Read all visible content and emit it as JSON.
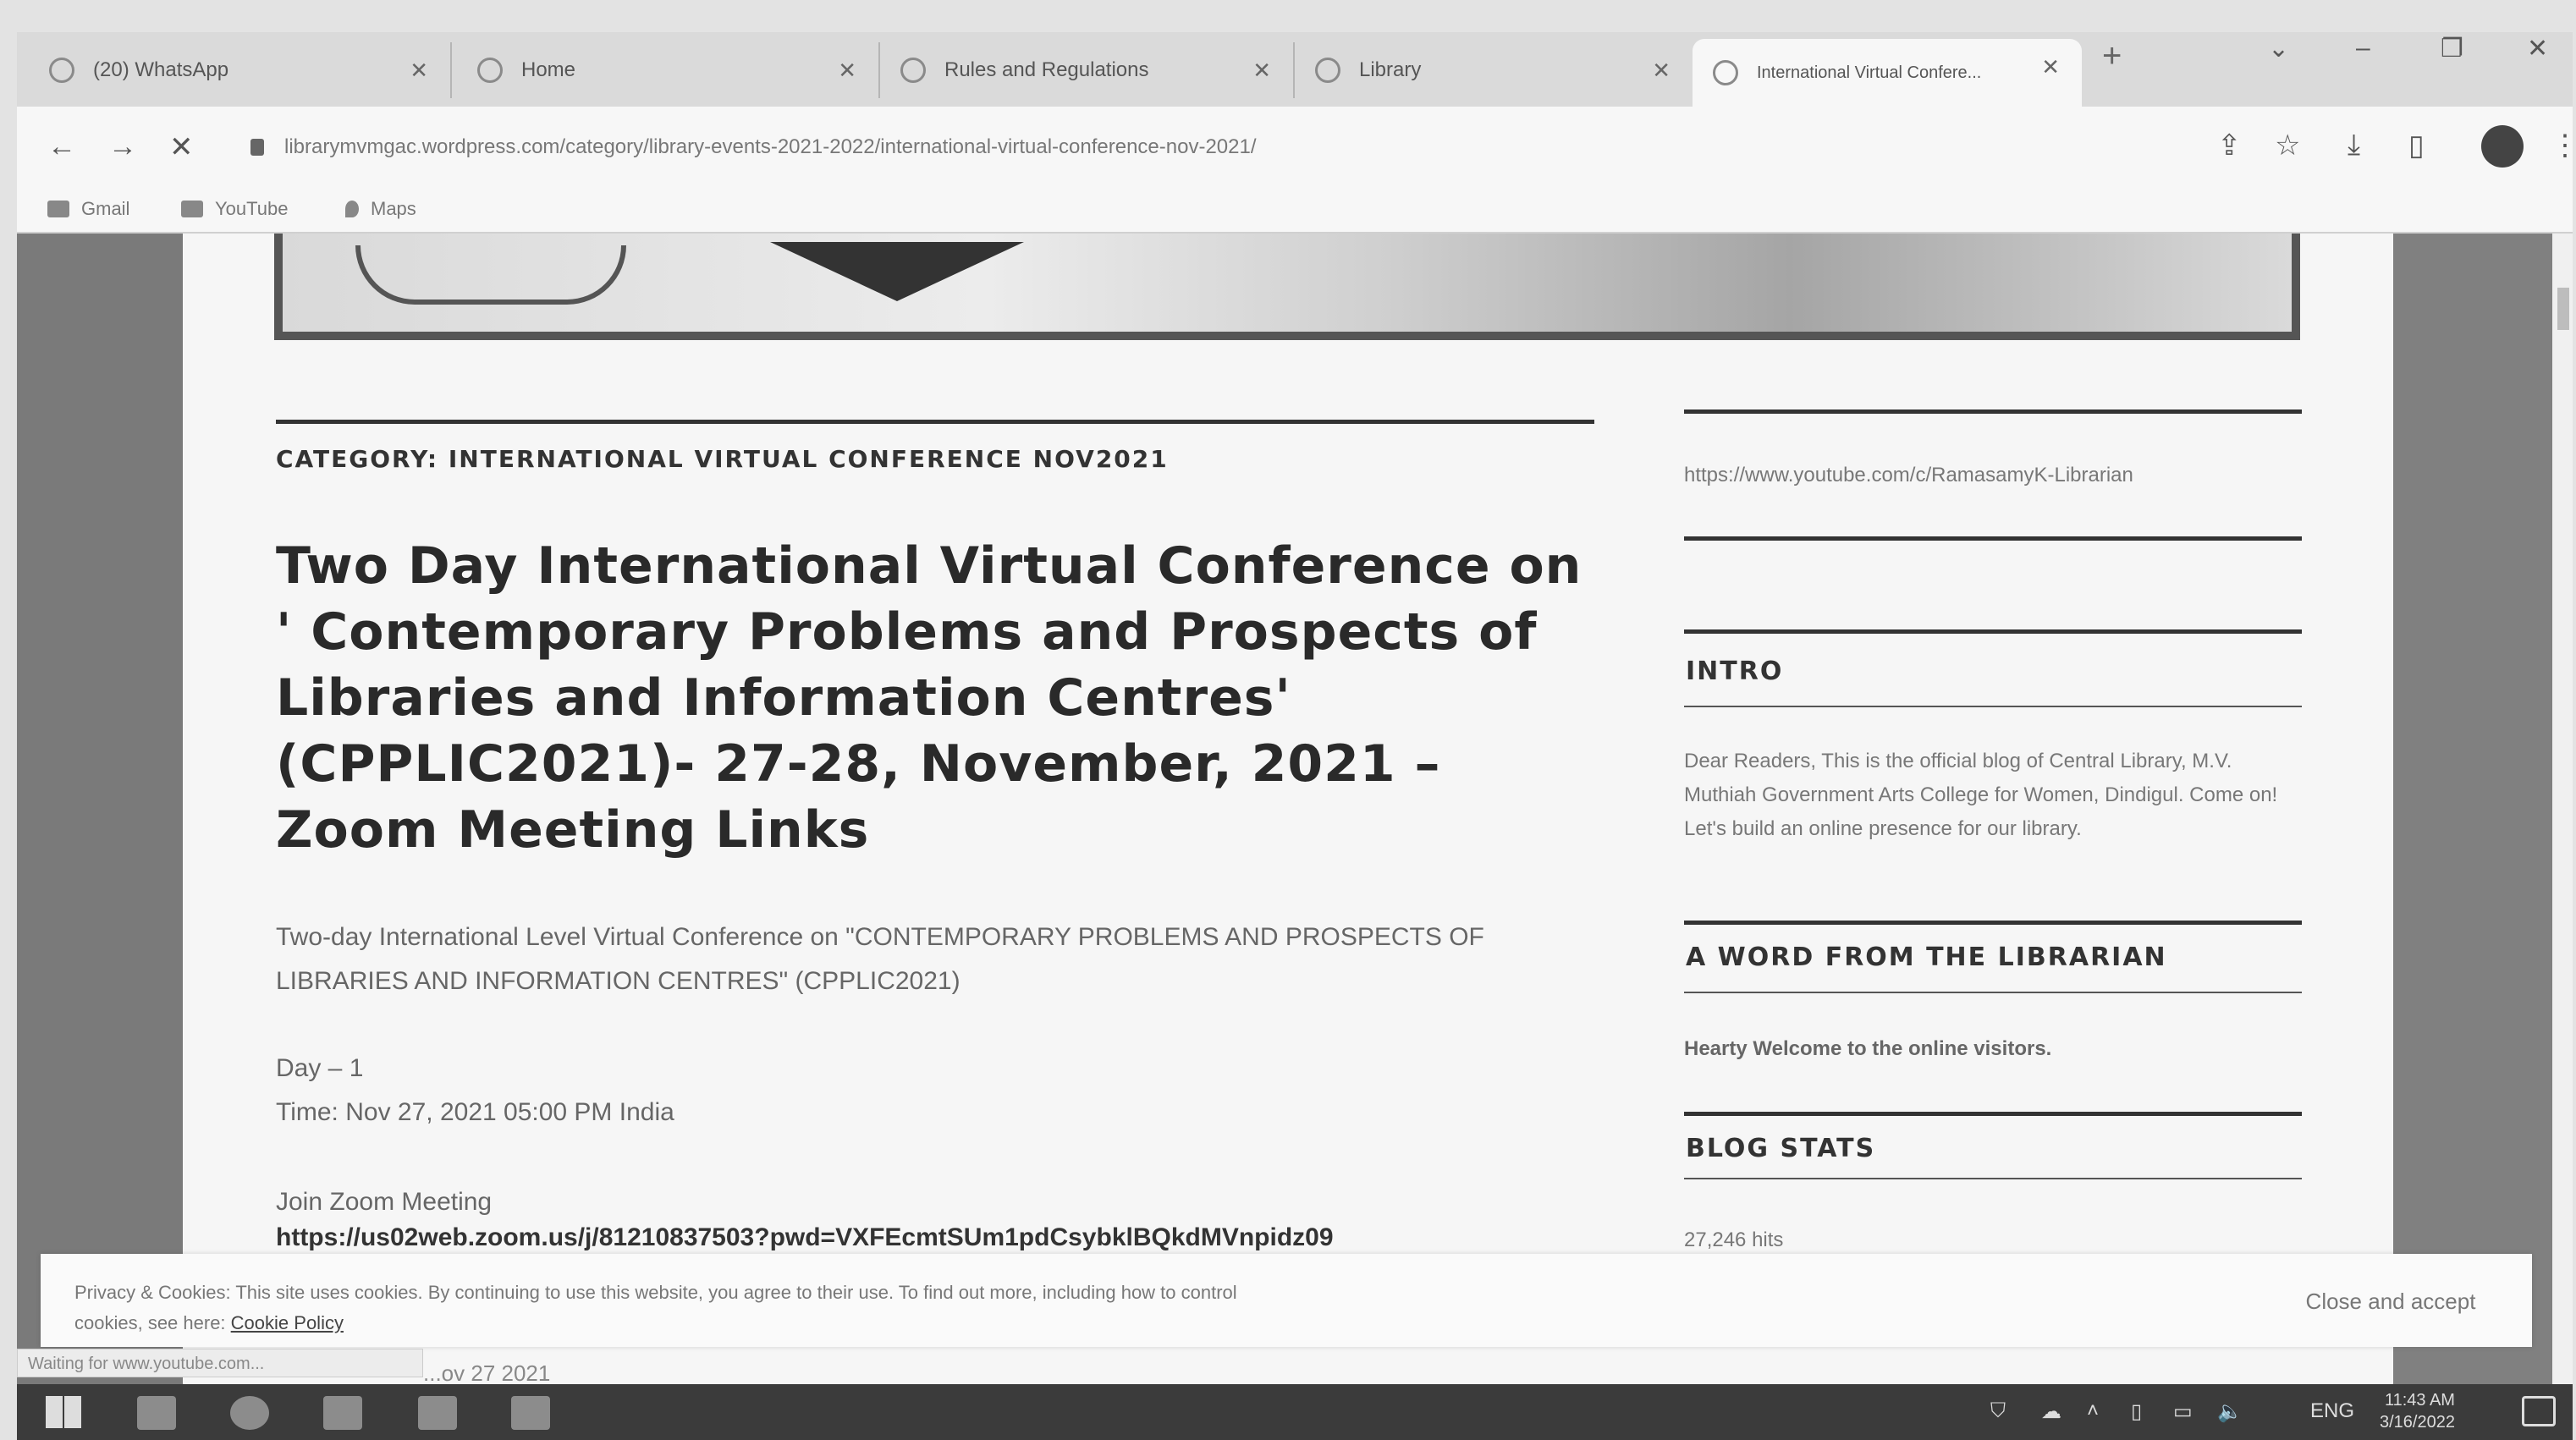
{
  "browser": {
    "tabs": [
      {
        "label": "(20) WhatsApp"
      },
      {
        "label": "Home"
      },
      {
        "label": "Rules and Regulations"
      },
      {
        "label": "Library"
      },
      {
        "label": "International Virtual Confere..."
      }
    ],
    "new_tab": "+",
    "address": "librarymvmgac.wordpress.com/category/library-events-2021-2022/international-virtual-conference-nov-2021/",
    "bookmarks": [
      "Gmail",
      "YouTube",
      "Maps"
    ]
  },
  "post": {
    "category": "CATEGORY: INTERNATIONAL VIRTUAL CONFERENCE NOV2021",
    "title": "Two Day International Virtual Conference on ' Contemporary Problems and Prospects of Libraries and Information Centres' (CPPLIC2021)- 27-28, November, 2021 – Zoom Meeting Links",
    "intro": "Two-day International Level Virtual Conference on \"CONTEMPORARY PROBLEMS AND PROSPECTS OF LIBRARIES AND INFORMATION CENTRES\" (CPPLIC2021)",
    "day": "Day – 1",
    "time": "Time: Nov 27, 2021 05:00 PM India",
    "join": "Join Zoom Meeting",
    "zoom_link": "https://us02web.zoom.us/j/81210837503?pwd=VXFEcmtSUm1pdCsybklBQkdMVnpidz09",
    "below_fold": "...ov 27 2021"
  },
  "sidebar": {
    "youtube_link": "https://www.youtube.com/c/RamasamyK-Librarian",
    "intro_title": "INTRO",
    "intro_body": "Dear Readers, This is the official blog of Central Library, M.V. Muthiah Government Arts College for Women, Dindigul. Come on! Let's build an online presence for our library.",
    "word_title": "A WORD FROM THE LIBRARIAN",
    "word_body": "Hearty Welcome to the online visitors.",
    "stats_title": "BLOG STATS",
    "stats_body": "27,246 hits"
  },
  "cookie": {
    "text": "Privacy & Cookies: This site uses cookies. By continuing to use this website, you agree to their use. To find out more, including how to control cookies, see here:",
    "policy": "Cookie Policy",
    "accept": "Close and accept"
  },
  "status": "Waiting for www.youtube.com...",
  "taskbar": {
    "lang": "ENG",
    "time": "11:43 AM",
    "date": "3/16/2022"
  }
}
